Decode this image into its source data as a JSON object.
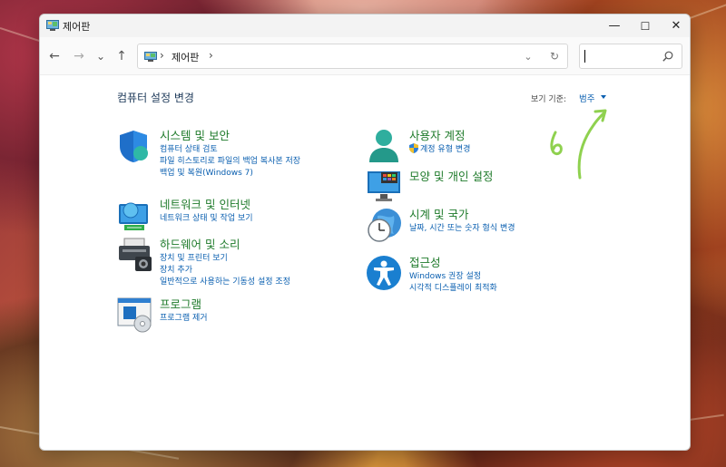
{
  "window": {
    "title": "제어판",
    "min_glyph": "—",
    "max_glyph": "☐",
    "close_glyph": "✕"
  },
  "nav": {
    "back": "←",
    "forward": "→",
    "recent": "⌄",
    "up": "↑",
    "breadcrumb_sep": "›",
    "breadcrumb": "제어판",
    "breadcrumb_sep2": "›",
    "dropdown": "⌄",
    "refresh": "↻"
  },
  "search": {
    "value": "",
    "placeholder": ""
  },
  "page": {
    "title": "컴퓨터 설정 변경",
    "view_by_label": "보기 기준:",
    "view_by_value": "범주"
  },
  "categories_left": [
    {
      "title": "시스템 및 보안",
      "icon": "shield-icon",
      "links": [
        "컴퓨터 상태 검토",
        "파일 히스토리로 파일의 백업 복사본 저장",
        "백업 및 복원(Windows 7)"
      ]
    },
    {
      "title": "네트워크 및 인터넷",
      "icon": "network-icon",
      "links": [
        "네트워크 상태 및 작업 보기"
      ]
    },
    {
      "title": "하드웨어 및 소리",
      "icon": "printer-icon",
      "links": [
        "장치 및 프린터 보기",
        "장치 추가",
        "일반적으로 사용하는 기동성 설정 조정"
      ]
    },
    {
      "title": "프로그램",
      "icon": "programs-icon",
      "links": [
        "프로그램 제거"
      ]
    }
  ],
  "categories_right": [
    {
      "title": "사용자 계정",
      "icon": "user-icon",
      "links": [
        "계정 유형 변경"
      ]
    },
    {
      "title": "모양 및 개인 설정",
      "icon": "appearance-icon",
      "links": []
    },
    {
      "title": "시계 및 국가",
      "icon": "clock-globe-icon",
      "links": [
        "날짜, 시간 또는 숫자 형식 변경"
      ]
    },
    {
      "title": "접근성",
      "icon": "accessibility-icon",
      "links": [
        "Windows 권장 설정",
        "시각적 디스플레이 최적화"
      ]
    }
  ],
  "colors": {
    "category_title": "#1e7a2a",
    "link": "#0a5fb0",
    "annotation": "#8fd14f"
  }
}
